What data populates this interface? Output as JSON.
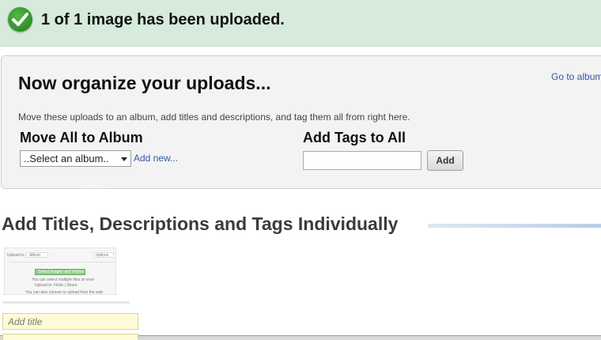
{
  "banner": {
    "message": "1 of 1 image has been uploaded.",
    "icon": "checkmark-icon",
    "color": "#d6ebdc"
  },
  "organize": {
    "title": "Now organize your uploads...",
    "goto_album_link": "Go to album",
    "description": "Move these uploads to an album, add titles and descriptions, and tag them all from right here.",
    "move_label": "Move All to Album",
    "album_select_value": "..Select an album..",
    "add_new_link": "Add new...",
    "tags_label": "Add Tags to All",
    "tags_value": "",
    "add_button": "Add"
  },
  "individual": {
    "heading": "Add Titles, Descriptions and Tags Individually",
    "thumbnail": {
      "upload_to": "Upload to:",
      "album_chip": "Album",
      "options_button": "options",
      "green_button": "Select Images and Videos",
      "line1": "You can select multiple files at once",
      "line2": "Upload to: Flickr | Share",
      "line3": "You can also choose to upload from the web"
    },
    "title_placeholder": "Add title"
  },
  "colors": {
    "accent_link": "#3355aa",
    "banner_bg": "#d6ebdc",
    "panel_bg": "#f3f3f3",
    "title_field_bg": "#fefcd6"
  }
}
